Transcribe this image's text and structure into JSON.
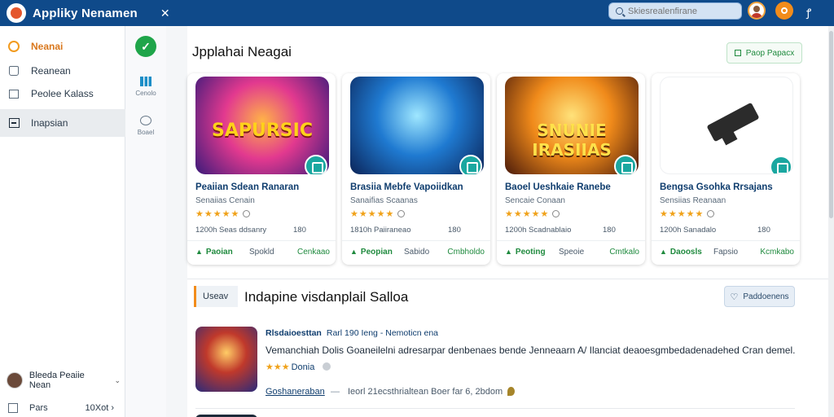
{
  "app": {
    "title": "Appliky Nenamen",
    "close_glyph": "✕",
    "search_placeholder": "Skiesrealenfirane",
    "settings_glyph": "ꝭ",
    "colors": {
      "topbar": "#0f4a8a",
      "accent": "#f28c1b",
      "success": "#1f8a3e",
      "teal": "#1aa7a0"
    }
  },
  "sidebar": {
    "items": [
      {
        "label": "Neanai",
        "icon": "home-icon"
      },
      {
        "label": "Reanean",
        "icon": "bag-icon"
      },
      {
        "label": "Peolee Kalass",
        "icon": "box-icon"
      },
      {
        "label": "Inapsian",
        "icon": "panel-icon"
      }
    ],
    "profile": {
      "name": "Bleeda Peaiie Nean",
      "chevron": "⌄"
    },
    "footer": {
      "label": "Pars",
      "version": "10Xot",
      "arrow": "›"
    }
  },
  "rail": {
    "add_glyph": "✓",
    "items": [
      {
        "label": "Cenolo",
        "icon": "chart-icon"
      },
      {
        "label": "Boael",
        "icon": "user-icon"
      }
    ]
  },
  "main": {
    "title": "Jpplahai Neagai",
    "action_label": "Paop Papacx",
    "cards": [
      {
        "thumb_text": "SAPURSIC",
        "name": "Peaiian Sdean Ranaran",
        "subtitle": "Senaiias Cenain",
        "stars": "★★★★★",
        "meta_left": "1200h Seas ddsanry",
        "meta_right": "180",
        "like": "Paoian",
        "mid": "Spokld",
        "right": "Cenkaao"
      },
      {
        "thumb_text": "",
        "name": "Brasiia Mebfe Vapoiidkan",
        "subtitle": "Sanaifias Scaanas",
        "stars": "★★★★★",
        "meta_left": "1810h Paiiraneao",
        "meta_right": "180",
        "like": "Peopian",
        "mid": "Sabido",
        "right": "Cmbholdo"
      },
      {
        "thumb_text": "SNUNIE IRASIIAS",
        "name": "Baoel Ueshkaie Ranebe",
        "subtitle": "Sencaie Conaan",
        "stars": "★★★★★",
        "meta_left": "1200h Scadnablaio",
        "meta_right": "180",
        "like": "Peoting",
        "mid": "Speoie",
        "right": "Cmtkalo"
      },
      {
        "thumb_text": "",
        "name": "Bengsa Gsohka Rrsajans",
        "subtitle": "Sensiias Reanaan",
        "stars": "★★★★★",
        "meta_left": "1200h Sanadalo",
        "meta_right": "180",
        "like": "Daoosls",
        "mid": "Fapsio",
        "right": "Kcmkabo"
      }
    ]
  },
  "section": {
    "tag": "Useav",
    "title": "Indapine visdanplail Salloa",
    "button": "Paddoenens",
    "item": {
      "title_bold": "Rlsdaioesttan",
      "title_rest": "Rarl 190 Ieng - Nemoticn ena",
      "description": "Vemanchiah Dolis Goaneilelni adresarpar denbenaes bende Jenneaarn A/ Ilanciat deaoesgmbedadenadehed Cran demel.",
      "stars": "★★★",
      "rating_label": "Donia",
      "link": "Goshaneraban",
      "meta_sep": "—",
      "meta": "Ieorl 21ecsthrialtean Boer far 6, 2bdom"
    }
  }
}
